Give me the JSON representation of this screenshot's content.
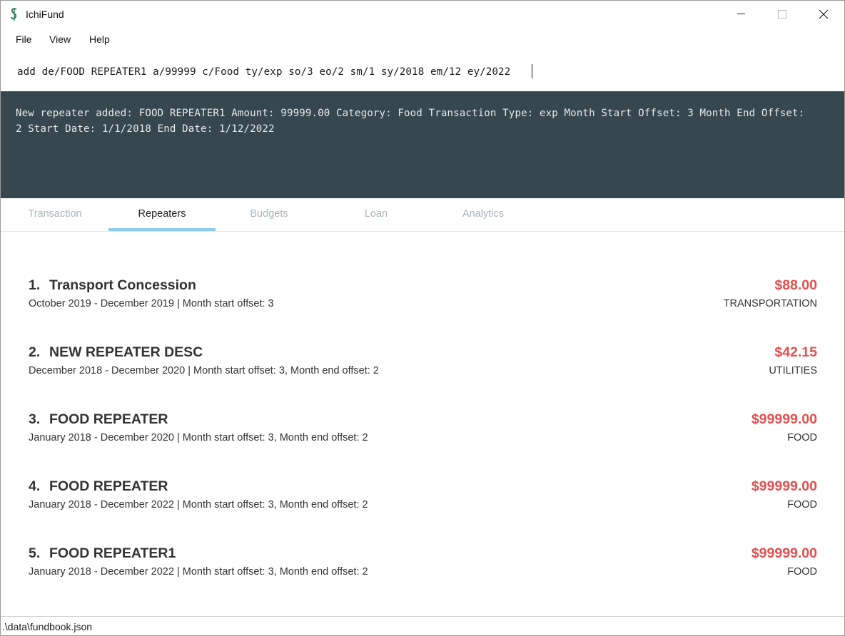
{
  "window": {
    "title": "IchiFund",
    "icon": "dollar-leaf-icon"
  },
  "menu": {
    "file": "File",
    "view": "View",
    "help": "Help"
  },
  "command": {
    "value": "add de/FOOD REPEATER1 a/99999 c/Food ty/exp so/3 eo/2 sm/1 sy/2018 em/12 ey/2022"
  },
  "result": {
    "text": "New repeater added: FOOD REPEATER1 Amount: 99999.00 Category: Food Transaction Type: exp Month Start Offset: 3 Month End Offset: 2 Start Date: 1/1/2018 End Date: 1/12/2022"
  },
  "tabs": [
    {
      "label": "Transaction"
    },
    {
      "label": "Repeaters"
    },
    {
      "label": "Budgets"
    },
    {
      "label": "Loan"
    },
    {
      "label": "Analytics"
    }
  ],
  "active_tab": "Repeaters",
  "repeaters": [
    {
      "index": "1.",
      "name": "Transport Concession",
      "period": "October 2019 - December 2019  |  Month start offset: 3",
      "amount": "$88.00",
      "category": "TRANSPORTATION"
    },
    {
      "index": "2.",
      "name": "NEW REPEATER DESC",
      "period": "December 2018 - December 2020  |  Month start offset: 3, Month end offset: 2",
      "amount": "$42.15",
      "category": "UTILITIES"
    },
    {
      "index": "3.",
      "name": "FOOD REPEATER",
      "period": "January 2018 - December 2020  |  Month start offset: 3, Month end offset: 2",
      "amount": "$99999.00",
      "category": "FOOD"
    },
    {
      "index": "4.",
      "name": "FOOD REPEATER",
      "period": "January 2018 - December 2022  |  Month start offset: 3, Month end offset: 2",
      "amount": "$99999.00",
      "category": "FOOD"
    },
    {
      "index": "5.",
      "name": "FOOD REPEATER1",
      "period": "January 2018 - December 2022  |  Month start offset: 3, Month end offset: 2",
      "amount": "$99999.00",
      "category": "FOOD"
    }
  ],
  "status": {
    "path": ".\\data\\fundbook.json"
  },
  "colors": {
    "result_bg": "#37474f",
    "amount": "#e4504f",
    "tab_indicator": "#8fcdee",
    "tab_inactive": "#aab4bd"
  }
}
